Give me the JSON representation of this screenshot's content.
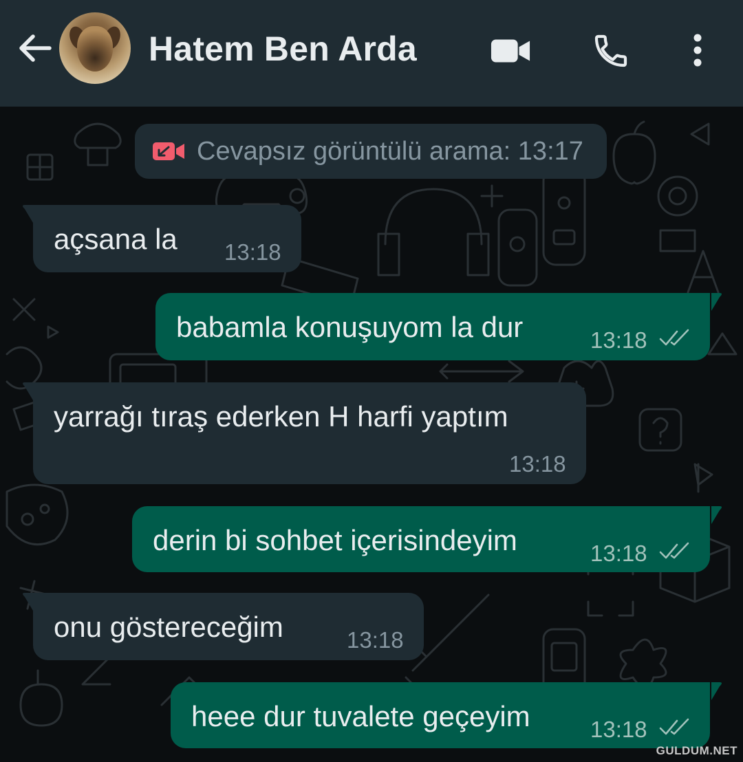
{
  "header": {
    "contact_name": "Hatem Ben Arda",
    "back_icon": "arrow-left-icon",
    "video_icon": "video-camera-icon",
    "call_icon": "phone-icon",
    "menu_icon": "more-vertical-icon"
  },
  "system_message": {
    "text": "Cevapsız görüntülü arama: 13:17",
    "icon": "missed-video-call-icon",
    "icon_color": "#f15c6d"
  },
  "messages": [
    {
      "direction": "in",
      "text": "açsana la",
      "time": "13:18"
    },
    {
      "direction": "out",
      "text": "babamla konuşuyom la dur",
      "time": "13:18",
      "status": "read"
    },
    {
      "direction": "in",
      "text": "yarrağı tıraş ederken H harfi yaptım",
      "time": "13:18"
    },
    {
      "direction": "out",
      "text": "derin bi sohbet içerisindeyim",
      "time": "13:18",
      "status": "read"
    },
    {
      "direction": "in",
      "text": "onu göstereceğim",
      "time": "13:18"
    },
    {
      "direction": "out",
      "text": "heee dur tuvalete geçeyim",
      "time": "13:18",
      "status": "read"
    }
  ],
  "watermark": "GULDUM.NET",
  "colors": {
    "header_bg": "#1f2c33",
    "chat_bg": "#0b0e10",
    "incoming_bubble": "#1f2c33",
    "outgoing_bubble": "#005c4b",
    "text": "#e9edef",
    "meta_text": "#8696a0"
  }
}
